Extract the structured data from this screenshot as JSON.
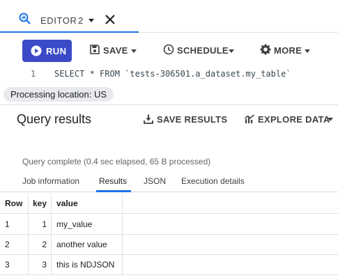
{
  "editor_tab": {
    "label": "EDITOR",
    "count": "2"
  },
  "toolbar": {
    "run_label": "RUN",
    "save_label": "SAVE",
    "schedule_label": "SCHEDULE",
    "more_label": "MORE"
  },
  "editor": {
    "line_number": "1",
    "code": "SELECT * FROM `tests-306501.a_dataset.my_table`"
  },
  "processing_location": "Processing location: US",
  "results": {
    "title": "Query results",
    "save_results_label": "SAVE RESULTS",
    "explore_data_label": "EXPLORE DATA",
    "status": "Query complete (0.4 sec elapsed, 65 B processed)",
    "tabs": [
      {
        "label": "Job information"
      },
      {
        "label": "Results"
      },
      {
        "label": "JSON"
      },
      {
        "label": "Execution details"
      }
    ],
    "active_tab": "Results",
    "columns": [
      "Row",
      "key",
      "value"
    ],
    "rows": [
      {
        "row": "1",
        "key": "1",
        "value": "my_value"
      },
      {
        "row": "2",
        "key": "2",
        "value": "another value"
      },
      {
        "row": "3",
        "key": "3",
        "value": "this is NDJSON"
      }
    ]
  },
  "colors": {
    "accent": "#1a73e8",
    "run_button": "#3b4bc8",
    "text": "#202124",
    "muted": "#5f6368"
  },
  "icons": {
    "editor_tab": "query-search-icon",
    "close": "close-icon",
    "run": "play-circle-icon",
    "save": "save-icon",
    "schedule": "schedule-clock-icon",
    "more": "gear-icon",
    "save_results": "download-icon",
    "explore_data": "chart-icon"
  }
}
